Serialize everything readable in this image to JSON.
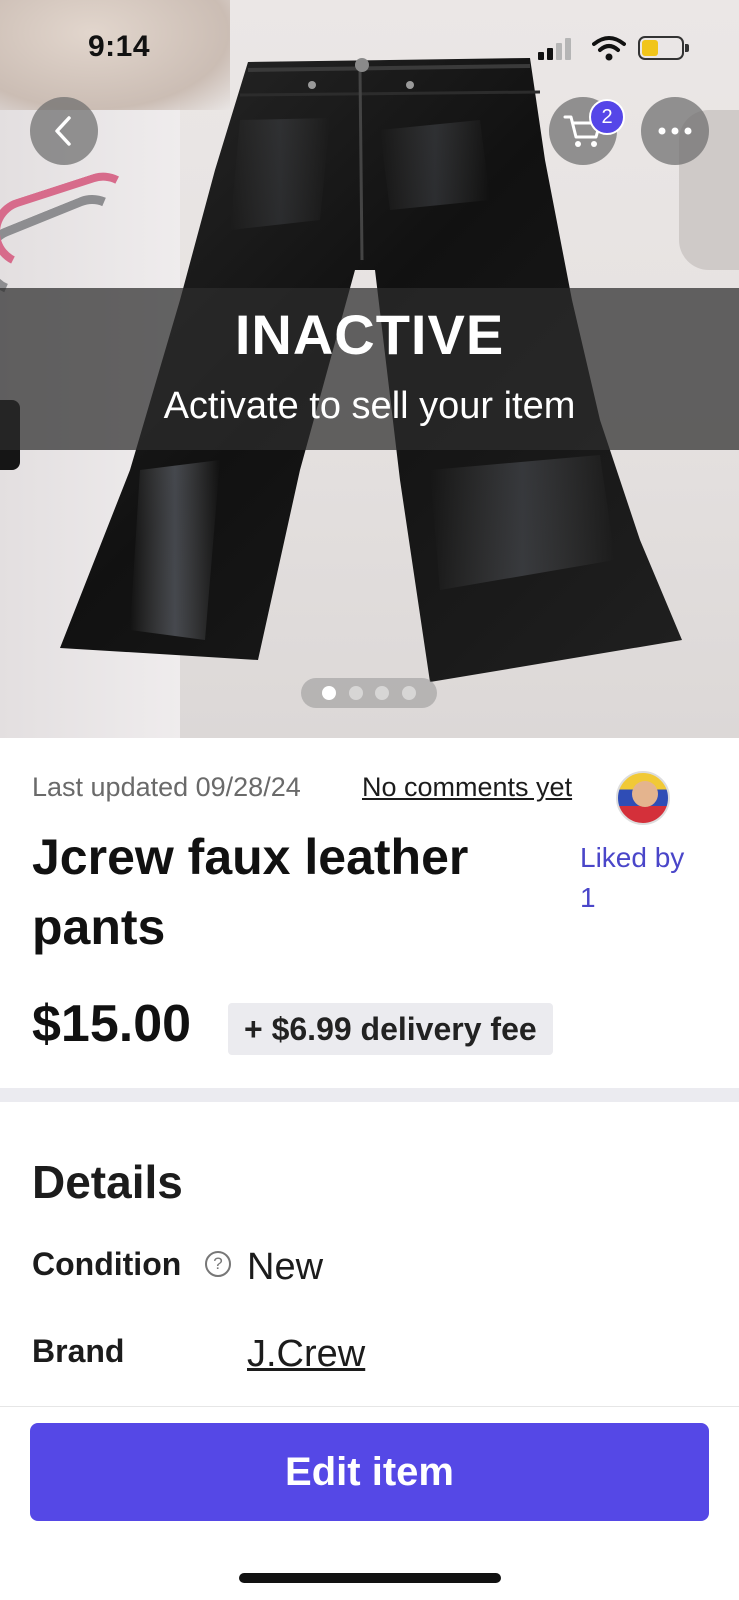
{
  "status_bar": {
    "time": "9:14"
  },
  "listing": {
    "cart_count": "2",
    "inactive_title": "INACTIVE",
    "inactive_subtitle": "Activate to sell your item",
    "photo_count": 4,
    "active_photo_index": 0,
    "last_updated": "Last updated 09/28/24",
    "comments_link": "No comments yet",
    "title": "Jcrew faux leather pants",
    "liked_by_label": "Liked by",
    "liked_by_count": "1",
    "price": "$15.00",
    "delivery_fee": "+ $6.99 delivery fee"
  },
  "details": {
    "heading": "Details",
    "condition_label": "Condition",
    "help_glyph": "?",
    "condition_value": "New",
    "brand_label": "Brand",
    "brand_value": "J.Crew"
  },
  "actions": {
    "edit_label": "Edit item"
  },
  "icons": {
    "back": "chevron-left-icon",
    "cart": "cart-icon",
    "more": "more-horizontal-icon",
    "help": "help-circle-icon"
  },
  "colors": {
    "accent": "#5548e6",
    "liked_text": "#4a46c9",
    "battery": "#f1c51a"
  }
}
